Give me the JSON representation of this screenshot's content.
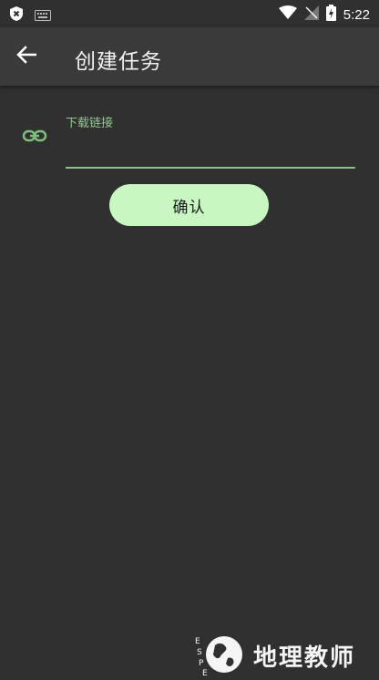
{
  "status_bar": {
    "time": "5:22",
    "icons": [
      "shield-x-icon",
      "keyboard-icon",
      "wifi-icon",
      "signal-icon",
      "battery-charging-icon"
    ]
  },
  "app_bar": {
    "title": "创建任务",
    "back_icon": "arrow-left-icon"
  },
  "form": {
    "url_field": {
      "label": "下载链接",
      "value": "",
      "icon": "link-icon"
    },
    "confirm_label": "确认"
  },
  "watermark": {
    "text": "地理教师",
    "logo_text": "E S P E"
  },
  "colors": {
    "background": "#303030",
    "app_bar": "#3a3a3a",
    "accent": "#8fc98b",
    "button": "#c8f7c1"
  }
}
